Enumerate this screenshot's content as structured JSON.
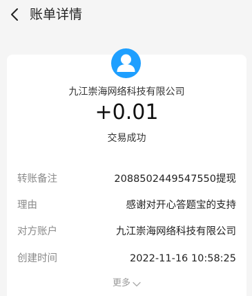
{
  "header": {
    "title": "账单详情"
  },
  "transaction": {
    "merchant": "九江崇海网络科技有限公司",
    "amount": "+0.01",
    "status": "交易成功"
  },
  "details": [
    {
      "label": "转账备注",
      "value": "2088502449547550提现"
    },
    {
      "label": "理由",
      "value": "感谢对开心答题宝的支持"
    },
    {
      "label": "对方账户",
      "value": "九江崇海网络科技有限公司"
    },
    {
      "label": "创建时间",
      "value": "2022-11-16 10:58:25"
    }
  ],
  "more": {
    "label": "更多"
  },
  "icons": {
    "back": "chevron-left-icon",
    "avatar": "user-avatar-icon",
    "more": "chevron-down-icon"
  },
  "colors": {
    "accent": "#1e9fff",
    "background": "#f5f5f5"
  }
}
